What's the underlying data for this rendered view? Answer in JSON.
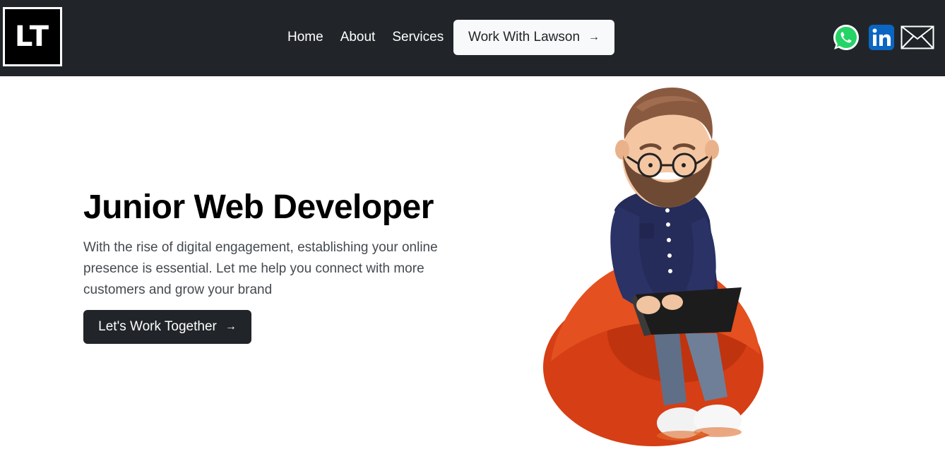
{
  "brand": {
    "logo_text": "LT"
  },
  "nav": {
    "links": [
      {
        "label": "Home"
      },
      {
        "label": "About"
      },
      {
        "label": "Services"
      }
    ],
    "cta_label": "Work With Lawson",
    "cta_arrow": "→"
  },
  "social": [
    {
      "icon": "whatsapp-icon",
      "color": "#25d366"
    },
    {
      "icon": "linkedin-icon",
      "label": "in",
      "color": "#0a66c2"
    },
    {
      "icon": "mail-icon",
      "color": "#ffffff"
    }
  ],
  "hero": {
    "title": "Junior Web Developer",
    "description": "With the rise of digital engagement, establishing your online presence is essential. Let me help you connect with more customers and grow your brand",
    "button_label": "Let's Work Together",
    "button_arrow": "→"
  },
  "illustration": {
    "icon": "developer-on-beanbag-illustration"
  },
  "colors": {
    "navbar_bg": "#212529",
    "nav_text": "#ffffff",
    "cta_bg": "#f8f9fa",
    "primary_button": "#212529",
    "beanbag": "#d63e15",
    "shirt": "#252c5a"
  }
}
